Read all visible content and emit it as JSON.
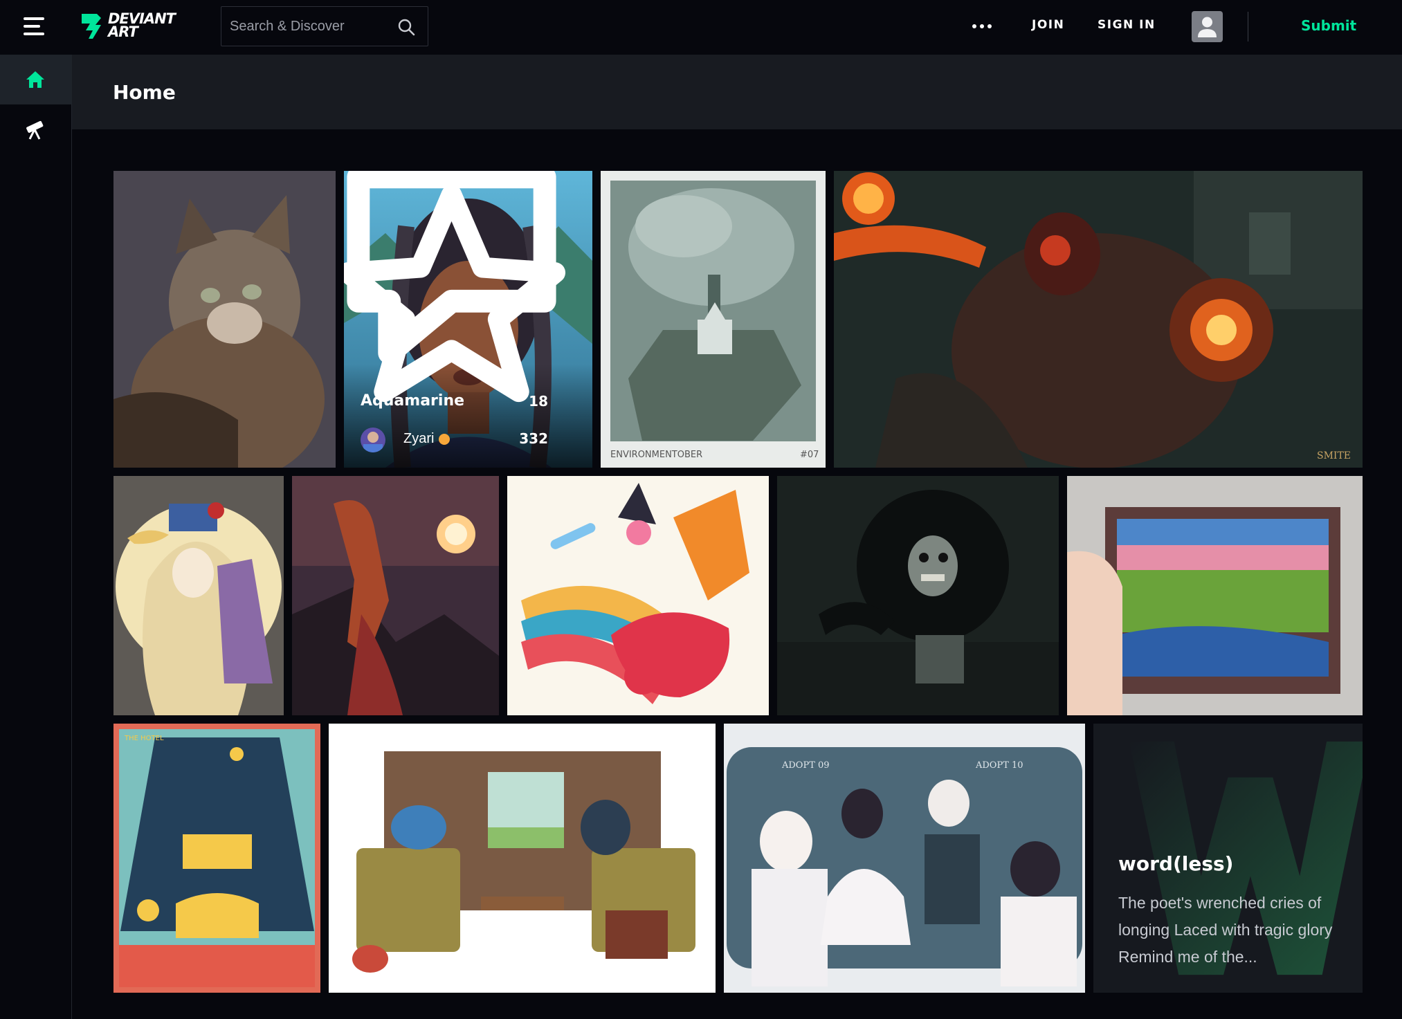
{
  "brand": {
    "logo_line1": "DEVIANT",
    "logo_line2": "ART",
    "accent_color": "#00e59b"
  },
  "search": {
    "placeholder": "Search & Discover"
  },
  "nav": {
    "join_label": "JOIN",
    "signin_label": "SIGN IN",
    "submit_label": "Submit",
    "more_icon": "more-dots-icon"
  },
  "sidebar": {
    "items": [
      {
        "icon": "home-icon",
        "active": true
      },
      {
        "icon": "telescope-icon",
        "active": false
      }
    ]
  },
  "page": {
    "title": "Home"
  },
  "featured": {
    "title": "Aquamarine",
    "author": "Zyari",
    "comments": "18",
    "favourites": "332"
  },
  "artwork_captions": {
    "environmentober_label": "ENVIRONMENTOBER",
    "environmentober_number": "#07",
    "hotel_label": "THE HOTEL",
    "adopt_left": "ADOPT 09",
    "adopt_right": "ADOPT 10",
    "smite_label": "SMITE"
  },
  "literature": {
    "title": "word(less)",
    "excerpt": "The poet's wrenched cries of longing Laced with tragic glory Remind me of the..."
  }
}
